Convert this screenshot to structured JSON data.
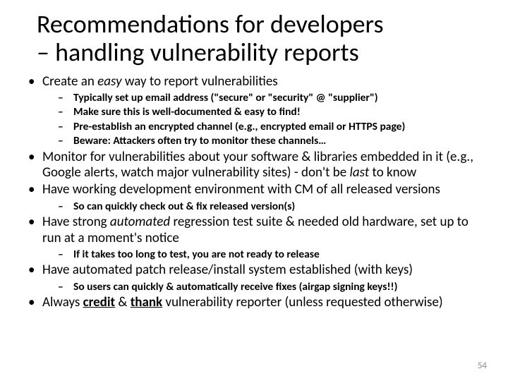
{
  "title_line1": "Recommendations for developers",
  "title_line2": "– handling vulnerability reports",
  "bullets": {
    "b1_pre": "Create an ",
    "b1_em": "easy",
    "b1_post": " way to report vulnerabilities",
    "b1_sub": [
      "Typically set up email address (\"secure\" or \"security\" @ \"supplier\")",
      "Make sure this is well-documented & easy to find!",
      "Pre-establish an encrypted channel (e.g., encrypted email or HTTPS page)",
      "Beware: Attackers often try to monitor these channels…"
    ],
    "b2_pre": "Monitor for vulnerabilities about your software & libraries embedded in it (e.g., Google alerts, watch major vulnerability sites) - don't be ",
    "b2_em": "last",
    "b2_post": " to know",
    "b3": "Have working development environment with CM of all released versions",
    "b3_sub": "So can quickly check out & fix released version(s)",
    "b4_pre": "Have strong ",
    "b4_em": "automated",
    "b4_post": " regression test suite & needed old hardware, set up to run at a moment's notice",
    "b4_sub": "If it takes too long to test, you are not ready to release",
    "b5": "Have automated patch release/install system established (with keys)",
    "b5_sub": "So users can quickly & automatically receive fixes (airgap signing keys!!)",
    "b6_pre": "Always ",
    "b6_w1": "credit",
    "b6_mid": " & ",
    "b6_w2": "thank",
    "b6_post": " vulnerability reporter (unless requested otherwise)"
  },
  "page_number": "54"
}
